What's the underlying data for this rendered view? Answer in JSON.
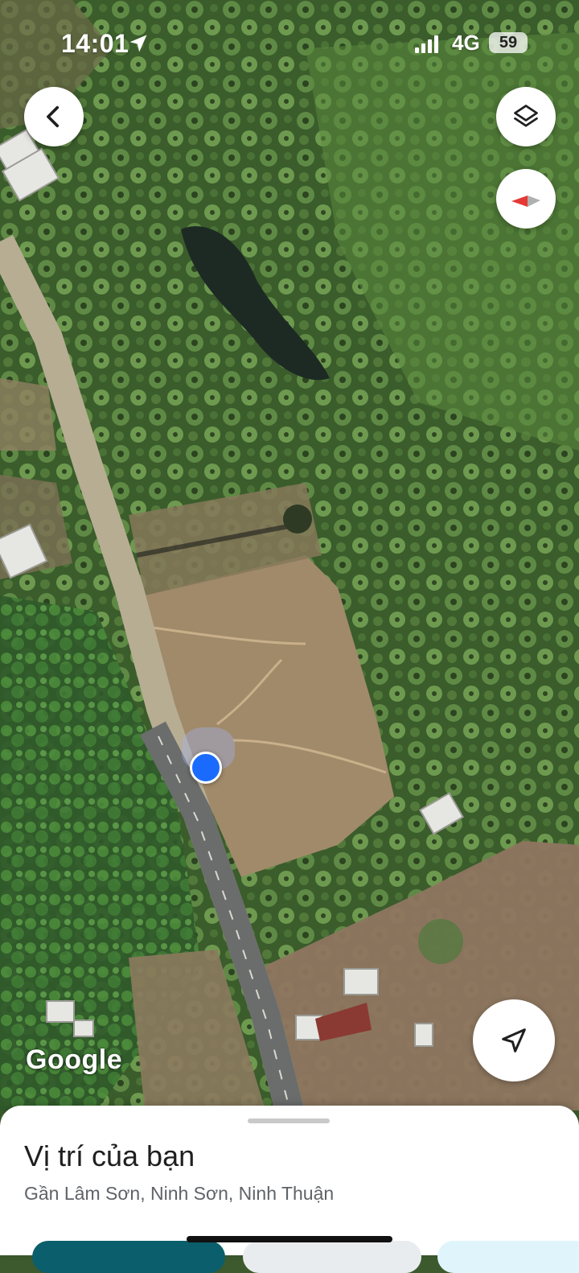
{
  "status_bar": {
    "time": "14:01",
    "network": "4G",
    "battery": "59"
  },
  "map": {
    "attribution": "Google",
    "type": "satellite"
  },
  "icons": {
    "back": "chevron-left-icon",
    "layers": "layers-icon",
    "compass": "compass-icon",
    "my_location": "navigation-arrow-icon"
  },
  "sheet": {
    "title": "Vị trí của bạn",
    "subtitle": "Gần Lâm Sơn, Ninh Sơn, Ninh Thuận"
  },
  "colors": {
    "location_dot": "#1a6bfd",
    "primary_chip": "#0b5e6b",
    "compass_red": "#e53935"
  }
}
